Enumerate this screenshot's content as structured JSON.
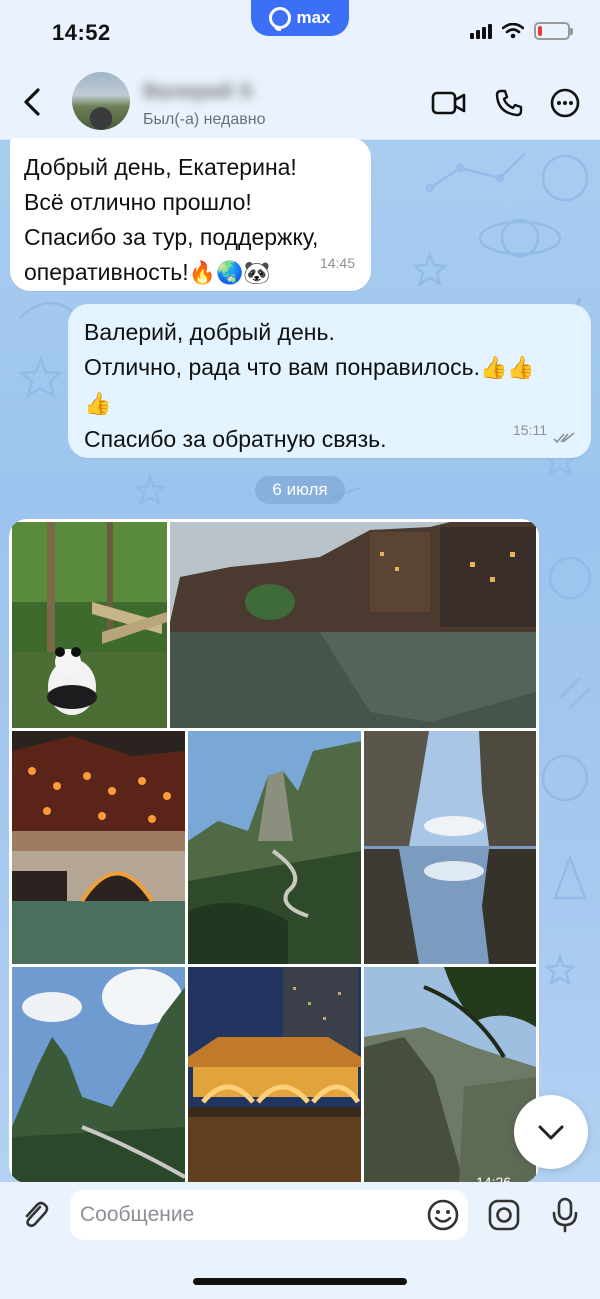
{
  "status_bar": {
    "time": "14:52",
    "app_badge": "max",
    "battery_level_pct": 15,
    "battery_color": "#e53935"
  },
  "header": {
    "contact_name": "Валерий S",
    "contact_status": "Был(-а) недавно",
    "icons": [
      "back-arrow-icon",
      "video-call-icon",
      "phone-icon",
      "more-icon"
    ]
  },
  "messages": [
    {
      "direction": "incoming",
      "lines": [
        "Добрый день, Екатерина!",
        "Всё отлично прошло!",
        "Спасибо за тур, поддержку,",
        "оперативность!"
      ],
      "emojis": "🔥🌏🐼",
      "time": "14:45"
    },
    {
      "direction": "outgoing",
      "lines": [
        "Валерий, добрый день.",
        "Отлично, рада что вам понравилось.",
        "Спасибо за обратную связь."
      ],
      "emojis_line2": "👍👍",
      "emojis_line3": "👍",
      "time": "15:11",
      "read": true
    }
  ],
  "date_separator": "6 июля",
  "album": {
    "photo_count": 8,
    "time": "14:26"
  },
  "composer": {
    "placeholder": "Сообщение",
    "value": ""
  },
  "colors": {
    "accent": "#3b6ff5",
    "incoming_bubble": "#ffffff",
    "outgoing_bubble": "#e3f3ff",
    "bar_bg": "#eaf3fd"
  }
}
